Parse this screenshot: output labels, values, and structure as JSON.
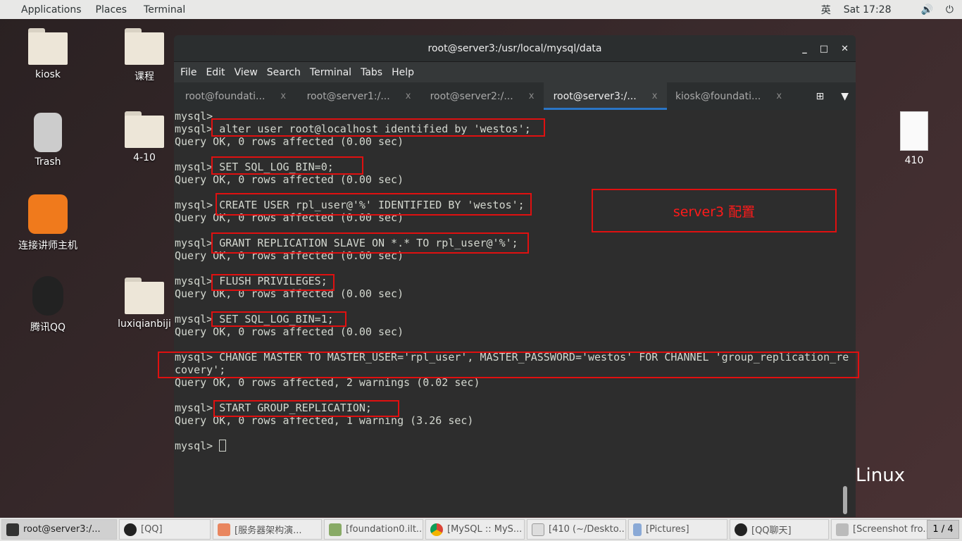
{
  "topbar": {
    "applications": "Applications",
    "places": "Places",
    "terminal": "Terminal",
    "ime": "英",
    "clock": "Sat 17:28",
    "volume_icon": "volume-icon",
    "power_icon": "power-icon"
  },
  "desktop": {
    "icons": [
      {
        "label": "kiosk"
      },
      {
        "label": "课程"
      },
      {
        "label": "Trash"
      },
      {
        "label": "4-10"
      },
      {
        "label": "连接讲师主机"
      },
      {
        "label": "腾讯QQ"
      },
      {
        "label": "luxiqianbiji"
      },
      {
        "label": "410"
      }
    ],
    "brand": "Linux"
  },
  "window": {
    "title": "root@server3:/usr/local/mysql/data",
    "menu": [
      "File",
      "Edit",
      "View",
      "Search",
      "Terminal",
      "Tabs",
      "Help"
    ],
    "tabs": [
      {
        "label": "root@foundati..."
      },
      {
        "label": "root@server1:/..."
      },
      {
        "label": "root@server2:/..."
      },
      {
        "label": "root@server3:/...",
        "active": true
      },
      {
        "label": "kiosk@foundati..."
      }
    ],
    "tab_close": "x"
  },
  "terminal": {
    "lines": [
      "mysql>",
      "mysql> alter user root@localhost identified by 'westos';",
      "Query OK, 0 rows affected (0.00 sec)",
      "",
      "mysql> SET SQL_LOG_BIN=0;",
      "Query OK, 0 rows affected (0.00 sec)",
      "",
      "mysql> CREATE USER rpl_user@'%' IDENTIFIED BY 'westos';",
      "Query OK, 0 rows affected (0.00 sec)",
      "",
      "mysql> GRANT REPLICATION SLAVE ON *.* TO rpl_user@'%';",
      "Query OK, 0 rows affected (0.00 sec)",
      "",
      "mysql> FLUSH PRIVILEGES;",
      "Query OK, 0 rows affected (0.00 sec)",
      "",
      "mysql> SET SQL_LOG_BIN=1;",
      "Query OK, 0 rows affected (0.00 sec)",
      "",
      "mysql> CHANGE MASTER TO MASTER_USER='rpl_user', MASTER_PASSWORD='westos' FOR CHANNEL 'group_replication_re",
      "covery';",
      "Query OK, 0 rows affected, 2 warnings (0.02 sec)",
      "",
      "mysql> START GROUP_REPLICATION;",
      "Query OK, 0 rows affected, 1 warning (3.26 sec)",
      ""
    ],
    "prompt": "mysql> "
  },
  "annotation": {
    "text": "server3 配置",
    "color": "#e01010"
  },
  "taskbar": {
    "items": [
      {
        "label": "root@server3:/..."
      },
      {
        "label": "[QQ]"
      },
      {
        "label": "[服务器架构演..."
      },
      {
        "label": "[foundation0.ilt...."
      },
      {
        "label": "[MySQL :: MyS..."
      },
      {
        "label": "[410 (~/Deskto..."
      },
      {
        "label": "[Pictures]"
      },
      {
        "label": "[QQ聊天]"
      },
      {
        "label": "[Screenshot fro..."
      }
    ],
    "pager": "1 / 4"
  }
}
